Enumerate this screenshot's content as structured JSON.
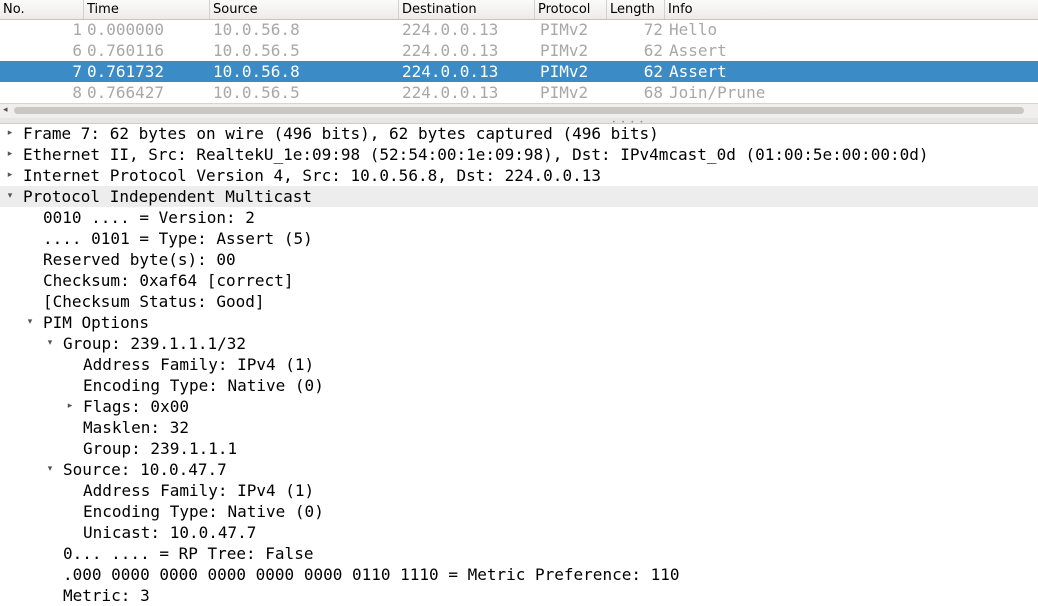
{
  "packet_list": {
    "columns": [
      "No.",
      "Time",
      "Source",
      "Destination",
      "Protocol",
      "Length",
      "Info"
    ],
    "rows": [
      {
        "no": "1",
        "time": "0.000000",
        "src": "10.0.56.8",
        "dst": "224.0.0.13",
        "proto": "PIMv2",
        "len": "72",
        "info": "Hello",
        "selected": false
      },
      {
        "no": "6",
        "time": "0.760116",
        "src": "10.0.56.5",
        "dst": "224.0.0.13",
        "proto": "PIMv2",
        "len": "62",
        "info": "Assert",
        "selected": false
      },
      {
        "no": "7",
        "time": "0.761732",
        "src": "10.0.56.8",
        "dst": "224.0.0.13",
        "proto": "PIMv2",
        "len": "62",
        "info": "Assert",
        "selected": true
      },
      {
        "no": "8",
        "time": "0.766427",
        "src": "10.0.56.5",
        "dst": "224.0.0.13",
        "proto": "PIMv2",
        "len": "68",
        "info": "Join/Prune",
        "selected": false
      }
    ],
    "scroll_left_arrow": "◂"
  },
  "details": [
    {
      "text": "Frame 7: 62 bytes on wire (496 bits), 62 bytes captured (496 bits)",
      "twisty": "▸"
    },
    {
      "text": "Ethernet II, Src: RealtekU_1e:09:98 (52:54:00:1e:09:98), Dst: IPv4mcast_0d (01:00:5e:00:00:0d)",
      "twisty": "▸"
    },
    {
      "text": "Internet Protocol Version 4, Src: 10.0.56.8, Dst: 224.0.0.13",
      "twisty": "▸"
    },
    {
      "text": "Protocol Independent Multicast",
      "twisty": "▾"
    },
    {
      "text": "0010 .... = Version: 2",
      "twisty": ""
    },
    {
      "text": ".... 0101 = Type: Assert (5)",
      "twisty": ""
    },
    {
      "text": "Reserved byte(s): 00",
      "twisty": ""
    },
    {
      "text": "Checksum: 0xaf64 [correct]",
      "twisty": ""
    },
    {
      "text": "[Checksum Status: Good]",
      "twisty": ""
    },
    {
      "text": "PIM Options",
      "twisty": "▾"
    },
    {
      "text": "Group: 239.1.1.1/32",
      "twisty": "▾"
    },
    {
      "text": "Address Family: IPv4 (1)",
      "twisty": ""
    },
    {
      "text": "Encoding Type: Native (0)",
      "twisty": ""
    },
    {
      "text": "Flags: 0x00",
      "twisty": "▸"
    },
    {
      "text": "Masklen: 32",
      "twisty": ""
    },
    {
      "text": "Group: 239.1.1.1",
      "twisty": ""
    },
    {
      "text": "Source: 10.0.47.7",
      "twisty": "▾"
    },
    {
      "text": "Address Family: IPv4 (1)",
      "twisty": ""
    },
    {
      "text": "Encoding Type: Native (0)",
      "twisty": ""
    },
    {
      "text": "Unicast: 10.0.47.7",
      "twisty": ""
    },
    {
      "text": "0... .... = RP Tree: False",
      "twisty": ""
    },
    {
      "text": ".000 0000 0000 0000 0000 0000 0110 1110 = Metric Preference: 110",
      "twisty": ""
    },
    {
      "text": "Metric: 3",
      "twisty": ""
    }
  ]
}
